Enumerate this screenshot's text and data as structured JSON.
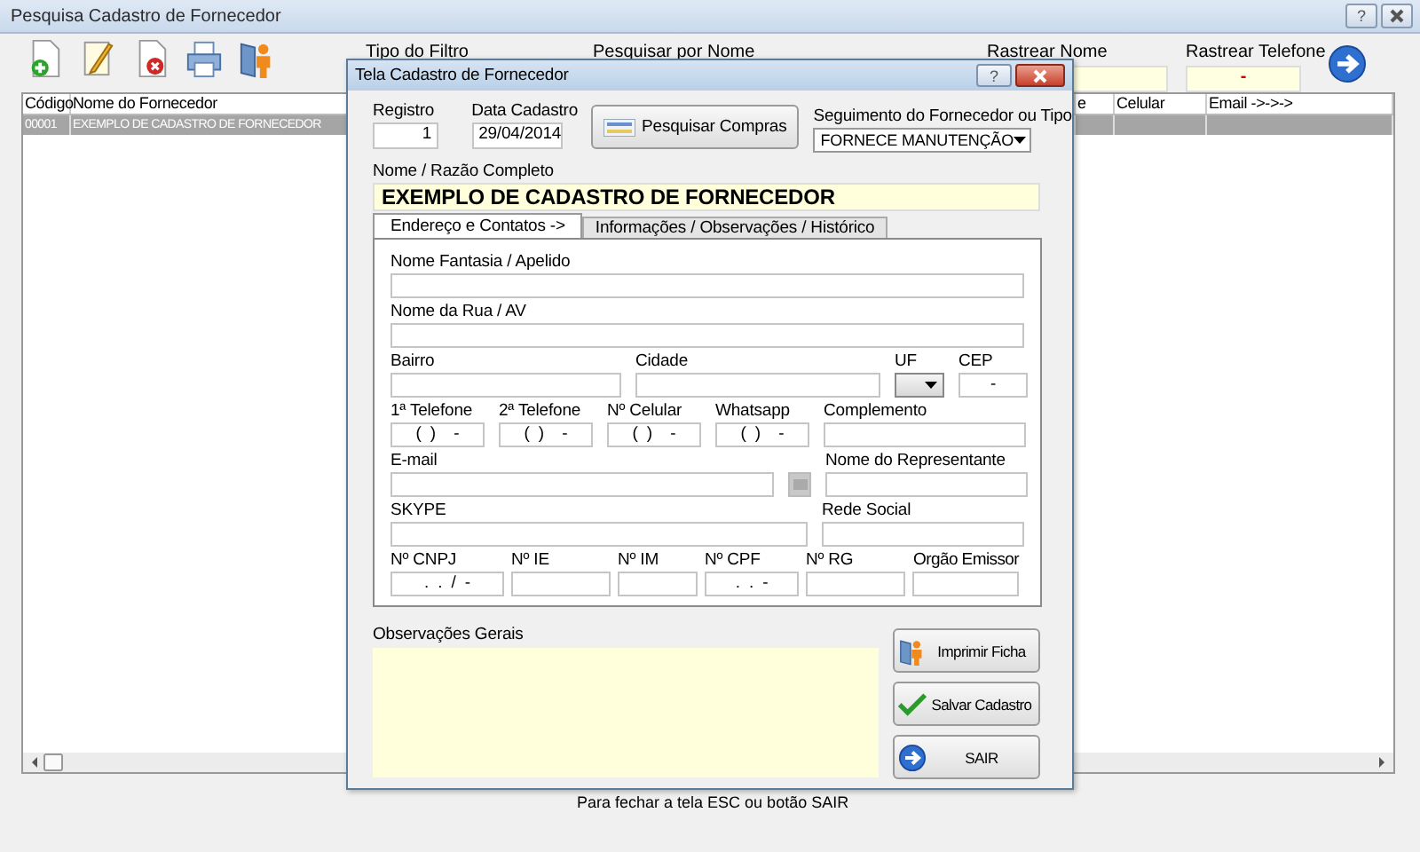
{
  "window": {
    "title": "Pesquisa Cadastro de Fornecedor",
    "help_label": "?"
  },
  "filters": [
    {
      "label": "Tipo do Filtro",
      "kind": "label"
    },
    {
      "label": "Pesquisar por Nome",
      "kind": "label"
    },
    {
      "label": "Rastrear Nome",
      "kind": "field"
    },
    {
      "label": "Rastrear Telefone",
      "kind": "field",
      "value": "-"
    }
  ],
  "table": {
    "columns": [
      "Código",
      "Nome do Fornecedor",
      "e",
      "Celular",
      "Email ->->->"
    ],
    "rows": [
      {
        "cells": [
          "00001",
          "EXEMPLO DE CADASTRO DE FORNECEDOR"
        ],
        "selected": true
      }
    ]
  },
  "footer": "Para fechar a tela ESC ou botão SAIR",
  "dialog": {
    "title": "Tela Cadastro de Fornecedor",
    "help_label": "?",
    "registro": {
      "label": "Registro",
      "value": "1"
    },
    "data_cadastro": {
      "label": "Data Cadastro",
      "value": "29/04/2014"
    },
    "search_button": "Pesquisar Compras",
    "segmento": {
      "label": "Seguimento do Fornecedor ou Tipo",
      "value": "FORNECE MANUTENÇÃO"
    },
    "nome": {
      "label": "Nome / Razão Completo",
      "value": "EXEMPLO DE CADASTRO DE FORNECEDOR"
    },
    "tabs": [
      {
        "label": "Endereço e Contatos ->",
        "selected": true
      },
      {
        "label": "Informações / Observações / Histórico",
        "selected": false
      }
    ],
    "form_rows": [
      [
        {
          "label": "Nome Fantasia / Apelido",
          "kind": "text"
        }
      ],
      [
        {
          "label": "Nome da Rua / AV",
          "kind": "text"
        }
      ],
      [
        {
          "label": "Bairro",
          "kind": "text"
        },
        {
          "label": "Cidade",
          "kind": "text"
        },
        {
          "label": "UF",
          "kind": "select"
        },
        {
          "label": "CEP",
          "kind": "text",
          "value": "-"
        }
      ],
      [
        {
          "label": "1ª Telefone",
          "kind": "text",
          "value": "(  )    -"
        },
        {
          "label": "2ª Telefone",
          "kind": "text",
          "value": "(  )    -"
        },
        {
          "label": "Nº Celular",
          "kind": "text",
          "value": "(  )    -"
        },
        {
          "label": "Whatsapp",
          "kind": "text",
          "value": "(  )    -"
        },
        {
          "label": "Complemento",
          "kind": "text"
        }
      ],
      [
        {
          "label": "E-mail",
          "kind": "text"
        },
        {
          "kind": "button",
          "disabled": true
        },
        {
          "label": "Nome do Representante",
          "kind": "text"
        }
      ],
      [
        {
          "label": "SKYPE",
          "kind": "text"
        },
        {
          "label": "Rede Social",
          "kind": "text"
        }
      ],
      [
        {
          "label": "Nº CNPJ",
          "kind": "text",
          "value": ".  .  /  -"
        },
        {
          "label": "Nº IE",
          "kind": "text"
        },
        {
          "label": "Nº IM",
          "kind": "text"
        },
        {
          "label": "Nº CPF",
          "kind": "text",
          "value": ".  .  -"
        },
        {
          "label": "Nº RG",
          "kind": "text"
        },
        {
          "label": "Orgão Emissor",
          "kind": "text"
        }
      ]
    ],
    "observacoes": {
      "label": "Observações Gerais"
    },
    "buttons": [
      {
        "label": "Imprimir Ficha",
        "kind": "print"
      },
      {
        "label": "Salvar Cadastro",
        "kind": "save"
      },
      {
        "label": "SAIR",
        "kind": "exit"
      }
    ]
  }
}
